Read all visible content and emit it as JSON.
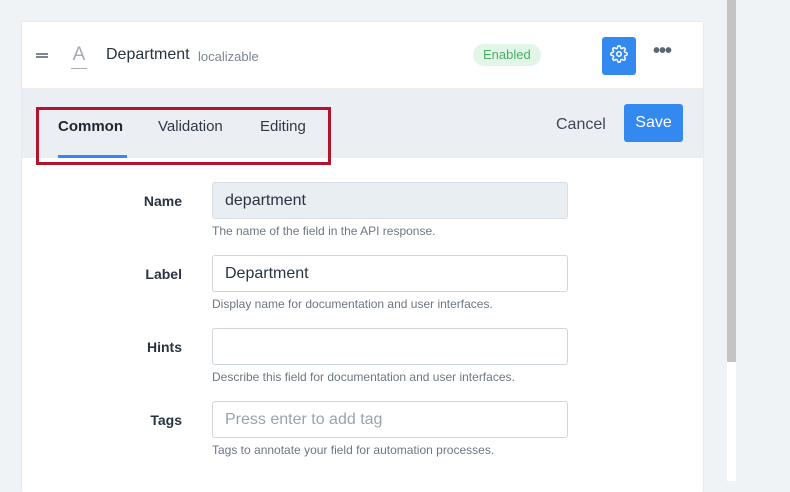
{
  "field": {
    "name": "Department",
    "meta": "localizable",
    "type_glyph": "A",
    "status": "Enabled"
  },
  "icons": {
    "drag": "drag-handle-icon",
    "type": "string-type-icon",
    "settings": "gear-icon",
    "more": "more-dots-icon"
  },
  "more_glyph": "•••",
  "tabs": [
    {
      "label": "Common",
      "active": true
    },
    {
      "label": "Validation",
      "active": false
    },
    {
      "label": "Editing",
      "active": false
    }
  ],
  "actions": {
    "cancel_label": "Cancel",
    "save_label": "Save"
  },
  "form": {
    "name": {
      "label": "Name",
      "value": "department",
      "hint": "The name of the field in the API response."
    },
    "label": {
      "label": "Label",
      "value": "Department",
      "hint": "Display name for documentation and user interfaces."
    },
    "hints": {
      "label": "Hints",
      "value": "",
      "hint": "Describe this field for documentation and user interfaces."
    },
    "tags": {
      "label": "Tags",
      "placeholder": "Press enter to add tag",
      "hint": "Tags to annotate your field for automation processes."
    }
  },
  "colors": {
    "accent": "#3389f0",
    "badge_bg": "#e2f6e7",
    "badge_text": "#4cae63",
    "highlight": "#b2142b"
  }
}
